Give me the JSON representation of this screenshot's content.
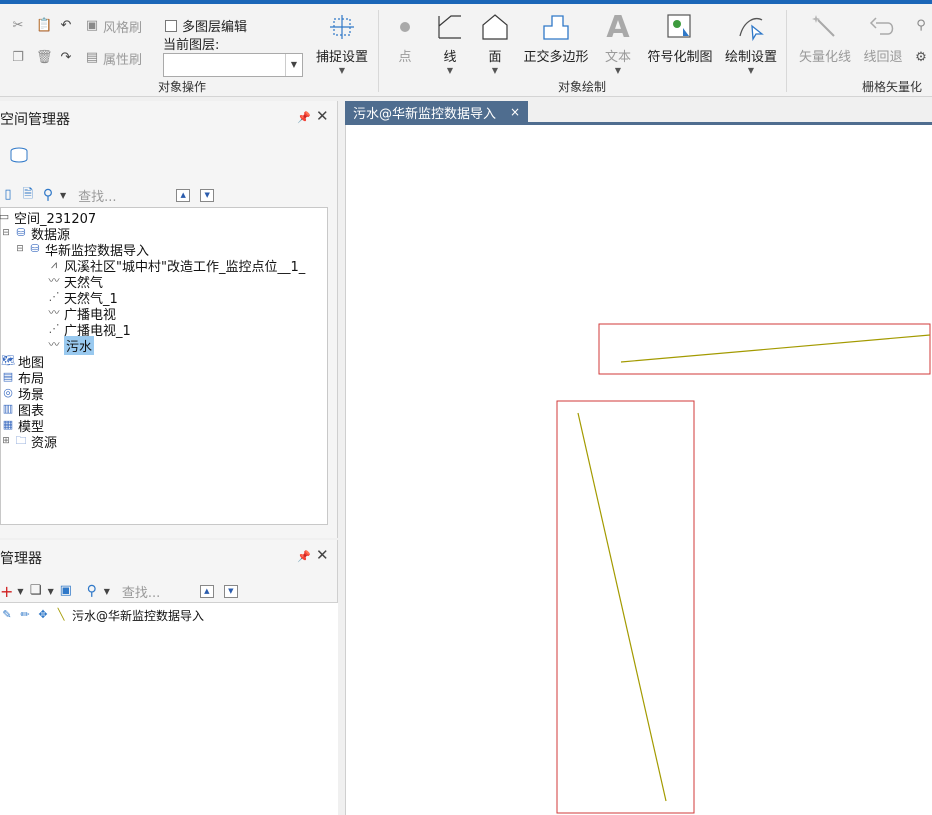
{
  "ribbon": {
    "small_buttons": {
      "style_brush": "风格刷",
      "attr_brush": "属性刷"
    },
    "multi_layer_edit": "多图层编辑",
    "current_layer_label": "当前图层:",
    "current_layer_value": "",
    "snap_settings": "捕捉设置",
    "draw_buttons": {
      "point": "点",
      "line": "线",
      "face": "面",
      "ortho_polygon": "正交多边形",
      "text": "文本",
      "symbol_draw": "符号化制图",
      "draw_settings": "绘制设置"
    },
    "raster_buttons": {
      "vectorize": "矢量化线",
      "line_undo": "线回退"
    },
    "groups": {
      "object_ops": "对象操作",
      "object_draw": "对象绘制",
      "raster_vector": "栅格矢量化"
    }
  },
  "workspace_panel": {
    "title": "空间管理器",
    "search_placeholder": "查找...",
    "tree": {
      "workspace": "空间_231207",
      "datasources": "数据源",
      "datasource": "华新监控数据导入",
      "datasets": [
        "风溪社区\"城中村\"改造工作_监控点位__1_",
        "天然气",
        "天然气_1",
        "广播电视",
        "广播电视_1",
        "污水"
      ],
      "selected_dataset": "污水",
      "maps": "地图",
      "layouts": "布局",
      "scenes": "场景",
      "charts": "图表",
      "models": "模型",
      "resources": "资源"
    }
  },
  "layer_panel": {
    "title": "管理器",
    "search_placeholder": "查找...",
    "layer_item": "污水@华新监控数据导入"
  },
  "map": {
    "tab_label": "污水@华新监控数据导入",
    "tab_close": "×",
    "line_color": "#a39a00",
    "box_color": "#d23a3a"
  },
  "icons": {
    "pin": "pin-icon",
    "close": "close-icon"
  }
}
